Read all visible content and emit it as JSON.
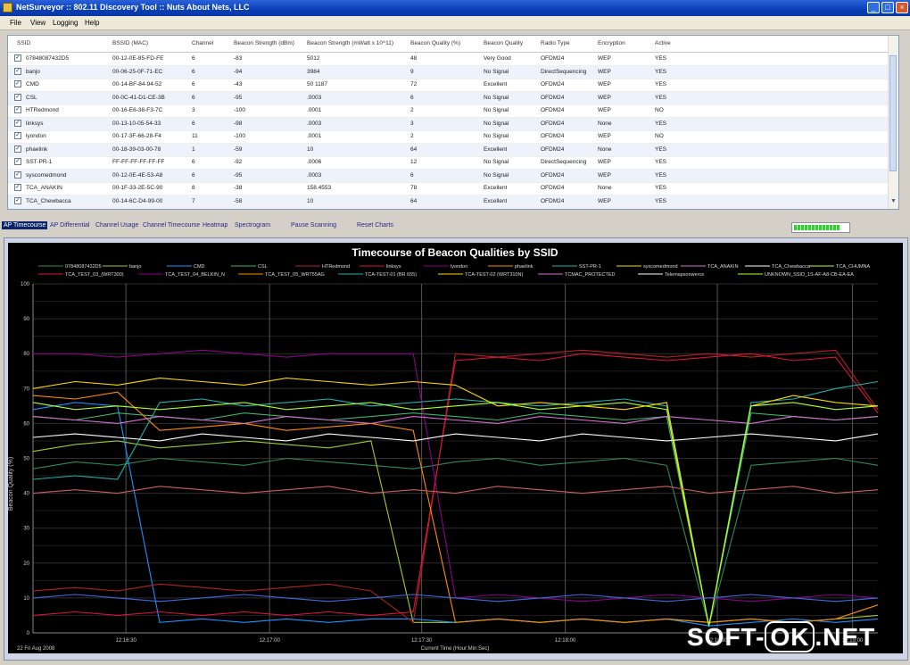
{
  "window": {
    "title": "NetSurveyor :: 802.11 Discovery Tool :: Nuts About Nets, LLC",
    "min_label": "_",
    "max_label": "□",
    "close_label": "×"
  },
  "menu": [
    "File",
    "View",
    "Logging",
    "Help"
  ],
  "table": {
    "columns": [
      "SSID",
      "BSSID (MAC)",
      "Channel",
      "Beacon Strength (dBm)",
      "Beacon Strength (mWatt x 10^11)",
      "Beacon Quality (%)",
      "Beacon Quality",
      "Radio Type",
      "Encryption",
      "Active"
    ],
    "rows": [
      [
        "07848087432D5",
        "00-12-0E-85-FD-FE",
        "6",
        "-83",
        "5012",
        "48",
        "Very Good",
        "OFDM24",
        "WEP",
        "YES"
      ],
      [
        "banjo",
        "00-06-25-0F-71-EC",
        "6",
        "-94",
        "3984",
        "9",
        "No Signal",
        "DirectSequencing",
        "WEP",
        "YES"
      ],
      [
        "CMD",
        "00-14-BF-84-94-52",
        "6",
        "-43",
        "50 1187",
        "72",
        "Excellent",
        "OFDM24",
        "WEP",
        "YES"
      ],
      [
        "CSL",
        "00-0C-41-D1-CE-3B",
        "6",
        "-95",
        ".0003",
        "6",
        "No Signal",
        "OFDM24",
        "WEP",
        "YES"
      ],
      [
        "HTRedmond",
        "00-16-E6-38-F3-7C",
        "3",
        "-100",
        ".0001",
        "2",
        "No Signal",
        "OFDM24",
        "WEP",
        "NO"
      ],
      [
        "linksys",
        "00-13-10-05-54-33",
        "6",
        "-98",
        ".0003",
        "3",
        "No Signal",
        "OFDM24",
        "None",
        "YES"
      ],
      [
        "lyondon",
        "00-17-3F-66-28-F4",
        "11",
        "-100",
        ".0001",
        "2",
        "No Signal",
        "OFDM24",
        "WEP",
        "NO"
      ],
      [
        "phaelink",
        "00-18-39-03-00-78",
        "1",
        "-59",
        "10",
        "64",
        "Excellent",
        "OFDM24",
        "None",
        "YES"
      ],
      [
        "SST-PR-1",
        "FF-FF-FF-FF-FF-FF",
        "6",
        "-92",
        ".0006",
        "12",
        "No Signal",
        "DirectSequencing",
        "WEP",
        "YES"
      ],
      [
        "syscomedmond",
        "00-12-0E-4E-53-A8",
        "6",
        "-95",
        ".0003",
        "6",
        "No Signal",
        "OFDM24",
        "WEP",
        "YES"
      ],
      [
        "TCA_ANAKIN",
        "00-1F-33-2E-5C-90",
        "8",
        "-38",
        "158.4553",
        "78",
        "Excellent",
        "OFDM24",
        "None",
        "YES"
      ],
      [
        "TCA_Chewbacca",
        "00-14-6C-D4-99-00",
        "7",
        "-58",
        "10",
        "64",
        "Excellent",
        "OFDM24",
        "WEP",
        "YES"
      ]
    ]
  },
  "tabs": [
    "AP Timecourse",
    "AP Differential",
    "Channel Usage",
    "Channel Timecourse",
    "Heatmap",
    "Spectrogram",
    "Pause Scanning",
    "Reset Charts"
  ],
  "progress": {
    "value": 0.85
  },
  "chart_data": {
    "type": "line",
    "title": "Timecourse of Beacon Qualities by SSID",
    "xlabel": "Current Time (Hour:Min:Sec)",
    "ylabel": "Beacon Quality (%)",
    "date_label": "22 Fri Aug 2008",
    "x_ticks": [
      "12:16:30",
      "12:17:00",
      "12:17:30",
      "12:18:00",
      "12:18:30",
      "12:19:00"
    ],
    "ylim": [
      0,
      100
    ],
    "y_ticks": [
      0,
      10,
      20,
      30,
      40,
      50,
      60,
      70,
      80,
      90,
      100
    ],
    "grid": true,
    "legend_row1": [
      "07848087432D5",
      "banjo",
      "CMD",
      "CSL",
      "HTRedmond",
      "linksys",
      "lyondon",
      "phaelink",
      "SST-PR-1",
      "syscomedmond",
      "TCA_ANAKIN",
      "TCA_Chewbacca",
      "TCA_CHUMNA"
    ],
    "legend_row2": [
      "TCA_TEST_03_(WRT300)",
      "TCA_TEST_04_BELKIN_N",
      "TCA_TEST_05_WRT55AG",
      "TCA-TEST-01 (BR 655)",
      "TCA-TEST-02 (WRT310N)",
      "TCMAC_PROTECTED",
      "Telemapsonwerce",
      "UNKNOWN_SSID_1S-AF-A8-CB-EA-EA"
    ],
    "x": [
      0,
      5,
      10,
      15,
      20,
      25,
      30,
      35,
      40,
      45,
      50,
      55,
      60,
      65,
      70,
      75,
      80,
      85,
      90,
      95,
      100
    ],
    "series": [
      {
        "color": "#2e8b57",
        "values": [
          47,
          49,
          48,
          50,
          49,
          48,
          50,
          49,
          48,
          47,
          49,
          50,
          48,
          49,
          50,
          48,
          2,
          48,
          49,
          50,
          48
        ]
      },
      {
        "color": "#9acd32",
        "values": [
          52,
          54,
          55,
          53,
          54,
          55,
          54,
          53,
          55,
          3,
          3,
          4,
          3,
          4,
          3,
          4,
          3,
          4,
          3,
          4,
          5
        ]
      },
      {
        "color": "#1e90ff",
        "values": [
          64,
          66,
          65,
          3,
          4,
          3,
          4,
          3,
          4,
          4,
          3,
          4,
          3,
          4,
          3,
          4,
          2,
          3,
          4,
          3,
          4
        ]
      },
      {
        "color": "#3cb371",
        "values": [
          62,
          61,
          63,
          62,
          61,
          63,
          62,
          61,
          62,
          63,
          62,
          61,
          63,
          62,
          61,
          62,
          2,
          63,
          62,
          61,
          62
        ]
      },
      {
        "color": "#b22222",
        "values": [
          12,
          13,
          12,
          14,
          13,
          12,
          13,
          14,
          12,
          3,
          80,
          79,
          80,
          81,
          80,
          79,
          80,
          79,
          80,
          81,
          64
        ]
      },
      {
        "color": "#dc143c",
        "values": [
          5,
          6,
          5,
          6,
          5,
          6,
          5,
          6,
          5,
          6,
          78,
          79,
          78,
          80,
          79,
          78,
          79,
          80,
          78,
          79,
          63
        ]
      },
      {
        "color": "#8b008b",
        "values": [
          80,
          80,
          79,
          80,
          81,
          80,
          79,
          80,
          80,
          80,
          10,
          11,
          10,
          9,
          10,
          11,
          10,
          9,
          10,
          11,
          10
        ]
      },
      {
        "color": "#ff8c00",
        "values": [
          68,
          67,
          69,
          58,
          59,
          60,
          58,
          59,
          60,
          58,
          3,
          4,
          3,
          4,
          3,
          4,
          3,
          4,
          3,
          4,
          8
        ]
      },
      {
        "color": "#20b2aa",
        "values": [
          44,
          45,
          44,
          66,
          67,
          65,
          66,
          67,
          65,
          66,
          67,
          66,
          65,
          66,
          67,
          65,
          2,
          66,
          67,
          70,
          72
        ]
      },
      {
        "color": "#ffd700",
        "values": [
          70,
          72,
          71,
          73,
          72,
          71,
          73,
          72,
          71,
          72,
          71,
          65,
          66,
          65,
          64,
          66,
          2,
          65,
          68,
          66,
          65
        ]
      },
      {
        "color": "#da70d6",
        "values": [
          62,
          61,
          60,
          62,
          61,
          60,
          62,
          61,
          60,
          62,
          61,
          60,
          62,
          61,
          60,
          62,
          61,
          60,
          62,
          61,
          62
        ]
      },
      {
        "color": "#ffffff",
        "values": [
          56,
          57,
          56,
          55,
          57,
          56,
          55,
          57,
          56,
          55,
          57,
          56,
          55,
          57,
          56,
          55,
          56,
          57,
          56,
          55,
          57
        ]
      },
      {
        "color": "#adff2f",
        "values": [
          66,
          64,
          65,
          64,
          65,
          66,
          64,
          65,
          66,
          64,
          65,
          66,
          64,
          65,
          66,
          64,
          2,
          65,
          66,
          64,
          65
        ]
      },
      {
        "color": "#4169e1",
        "values": [
          10,
          11,
          10,
          9,
          10,
          11,
          10,
          9,
          10,
          11,
          10,
          9,
          10,
          11,
          10,
          9,
          10,
          11,
          10,
          9,
          10
        ]
      },
      {
        "color": "#cd5c5c",
        "values": [
          40,
          41,
          40,
          42,
          41,
          40,
          41,
          42,
          40,
          41,
          40,
          42,
          41,
          40,
          41,
          42,
          40,
          41,
          42,
          40,
          41
        ]
      }
    ]
  },
  "watermark": {
    "left": "SOFT-",
    "ok": "OK",
    "right": ".NET"
  }
}
